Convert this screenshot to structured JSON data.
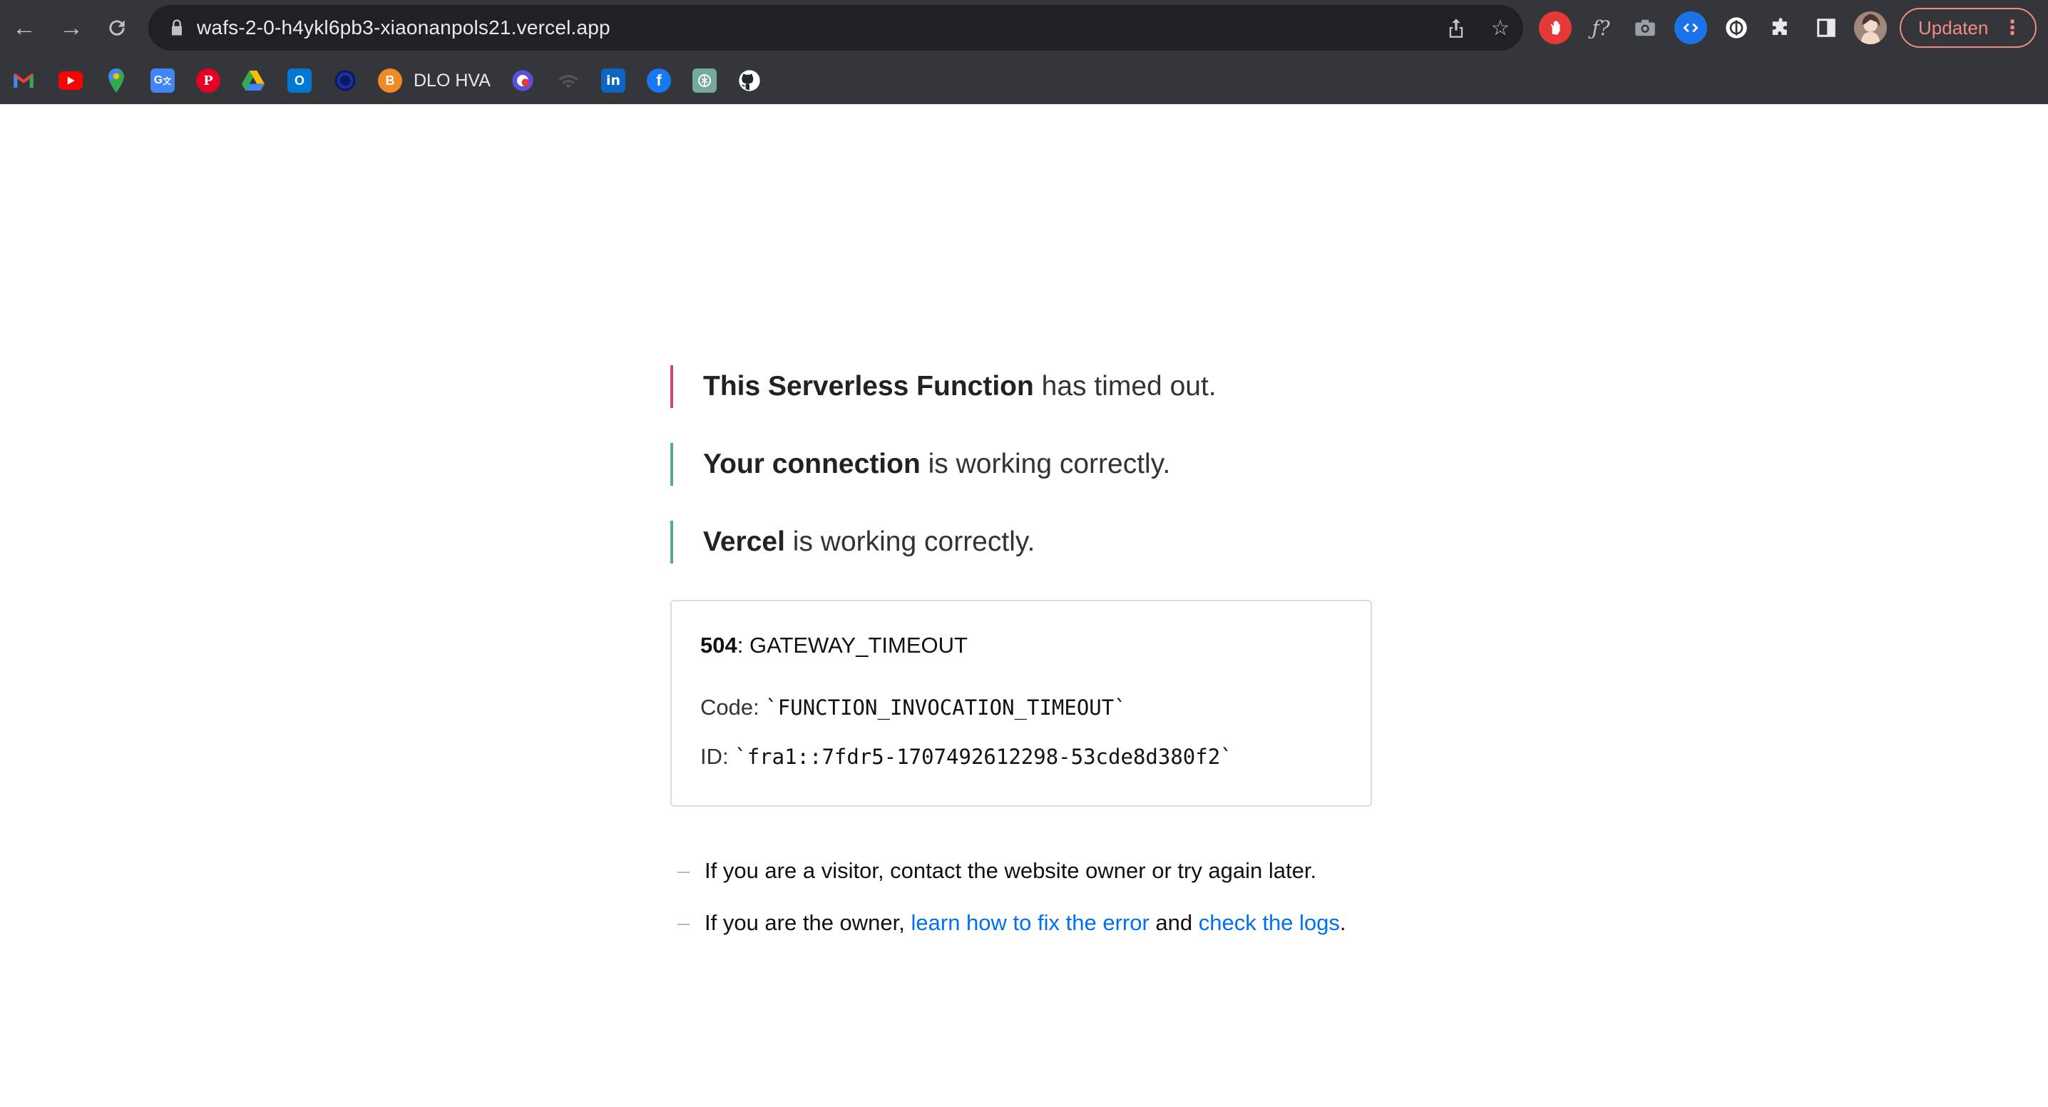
{
  "browser": {
    "url": "wafs-2-0-h4ykl6pb3-xiaonanpols21.vercel.app",
    "update_label": "Updaten",
    "bookmarks": {
      "dlo_label": "DLO HVA"
    },
    "colors": {
      "chrome_bg": "#35363a",
      "omnibox_bg": "#202124",
      "update_accent": "#f28b82"
    }
  },
  "page": {
    "status": [
      {
        "bold": "This Serverless Function",
        "rest": " has timed out.",
        "bar_color": "#d04a6a"
      },
      {
        "bold": "Your connection",
        "rest": " is working correctly.",
        "bar_color": "#5aa897"
      },
      {
        "bold": "Vercel",
        "rest": " is working correctly.",
        "bar_color": "#5aa897"
      }
    ],
    "error": {
      "status_code": "504",
      "status_name": ": GATEWAY_TIMEOUT",
      "code_label": "Code: ",
      "code_value": "`FUNCTION_INVOCATION_TIMEOUT`",
      "id_label": "ID: ",
      "id_value": "`fra1::7fdr5-1707492612298-53cde8d380f2`"
    },
    "help": {
      "dash": "–",
      "visitor_text": "If you are a visitor, contact the website owner or try again later.",
      "owner_prefix": "If you are the owner, ",
      "fix_link": "learn how to fix the error",
      "and_text": " and ",
      "logs_link": "check the logs",
      "period": "."
    },
    "link_color": "#0070f3"
  }
}
